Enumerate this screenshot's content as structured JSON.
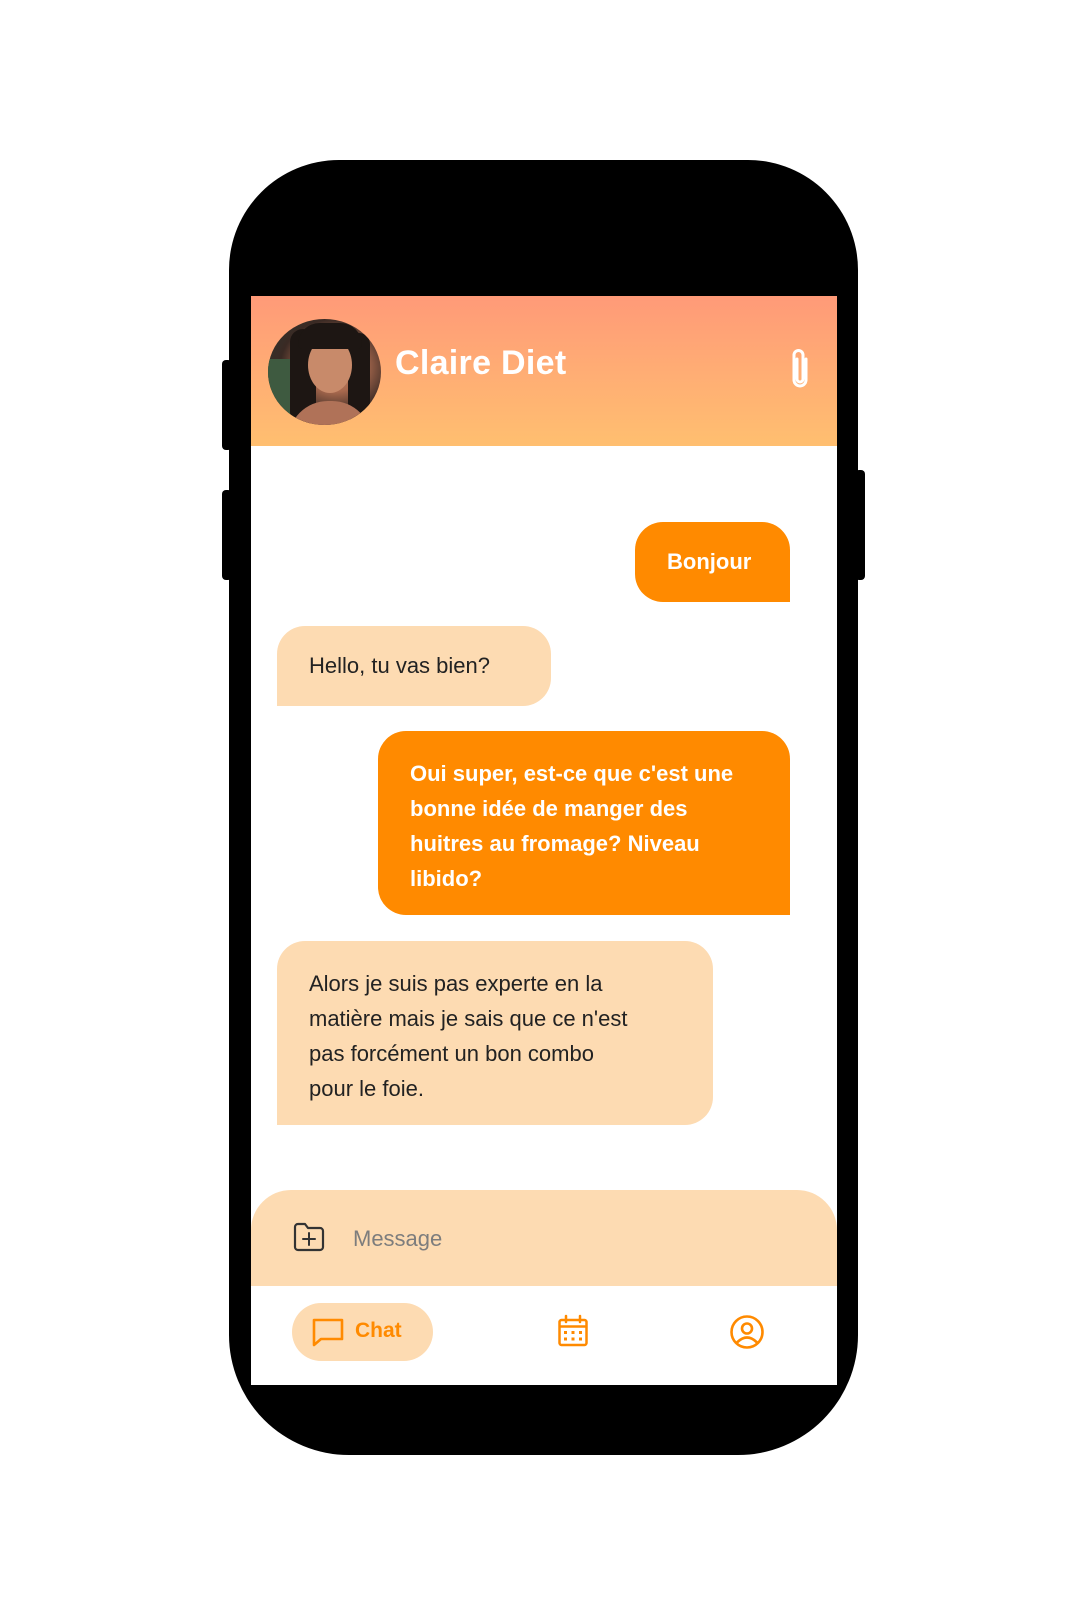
{
  "header": {
    "contact_name": "Claire Diet",
    "avatar": "contact-avatar-photo",
    "attach_icon": "paperclip-icon"
  },
  "messages": [
    {
      "direction": "outgoing",
      "text": "Bonjour"
    },
    {
      "direction": "incoming",
      "text": "Hello, tu vas bien?"
    },
    {
      "direction": "outgoing",
      "lines": [
        "Oui super, est-ce que c'est une",
        "bonne idée de manger des",
        "huitres au fromage? Niveau",
        "libido?"
      ]
    },
    {
      "direction": "incoming",
      "lines": [
        "Alors je suis pas experte en la",
        "matière mais je sais que ce n'est",
        "pas forcément un bon combo",
        "pour le foie."
      ]
    }
  ],
  "composer": {
    "placeholder": "Message",
    "value": "",
    "attach_icon": "folder-plus-icon"
  },
  "nav": {
    "items": [
      {
        "label": "Chat",
        "icon": "chat-bubble-icon",
        "active": true
      },
      {
        "label": "",
        "icon": "calendar-icon",
        "active": false
      },
      {
        "label": "",
        "icon": "profile-icon",
        "active": false
      }
    ]
  },
  "colors": {
    "accent": "#ff8a00",
    "incoming_bubble": "#fddbb2",
    "header_gradient_top": "#ff9a78",
    "header_gradient_bottom": "#ffbf70"
  }
}
